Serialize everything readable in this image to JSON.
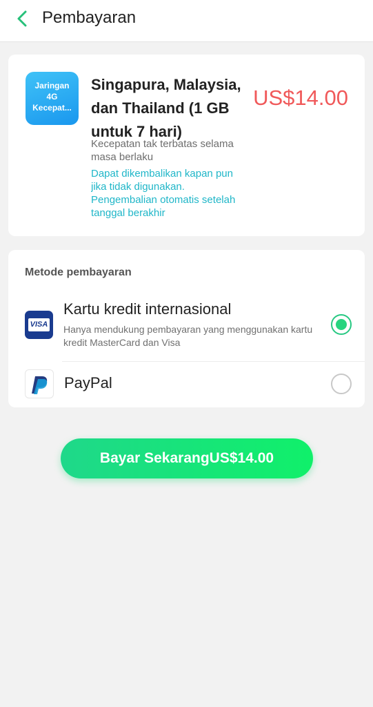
{
  "header": {
    "title": "Pembayaran"
  },
  "product": {
    "icon_lines": [
      "Jaringan",
      "4G",
      "Kecepat..."
    ],
    "name": "Singapura, Malaysia, dan Thailand (1 GB untuk 7 hari)",
    "price": "US$14.00",
    "description": "Kecepatan tak terbatas selama masa berlaku",
    "note": "Dapat dikembalikan kapan pun jika tidak digunakan. Pengembalian otomatis setelah tanggal berakhir"
  },
  "payment": {
    "title": "Metode pembayaran",
    "methods": [
      {
        "label": "Kartu kredit internasional",
        "subtitle": "Hanya mendukung pembayaran yang menggunakan kartu kredit MasterCard dan Visa",
        "icon_text": "VISA",
        "icon": "visa-icon",
        "selected": true
      },
      {
        "label": "PayPal",
        "icon": "paypal-icon",
        "selected": false
      }
    ]
  },
  "button": {
    "label": "Bayar SekarangUS$14.00"
  },
  "colors": {
    "accent": "#27d47f",
    "price": "#f0595a",
    "note": "#1fb6c8"
  }
}
